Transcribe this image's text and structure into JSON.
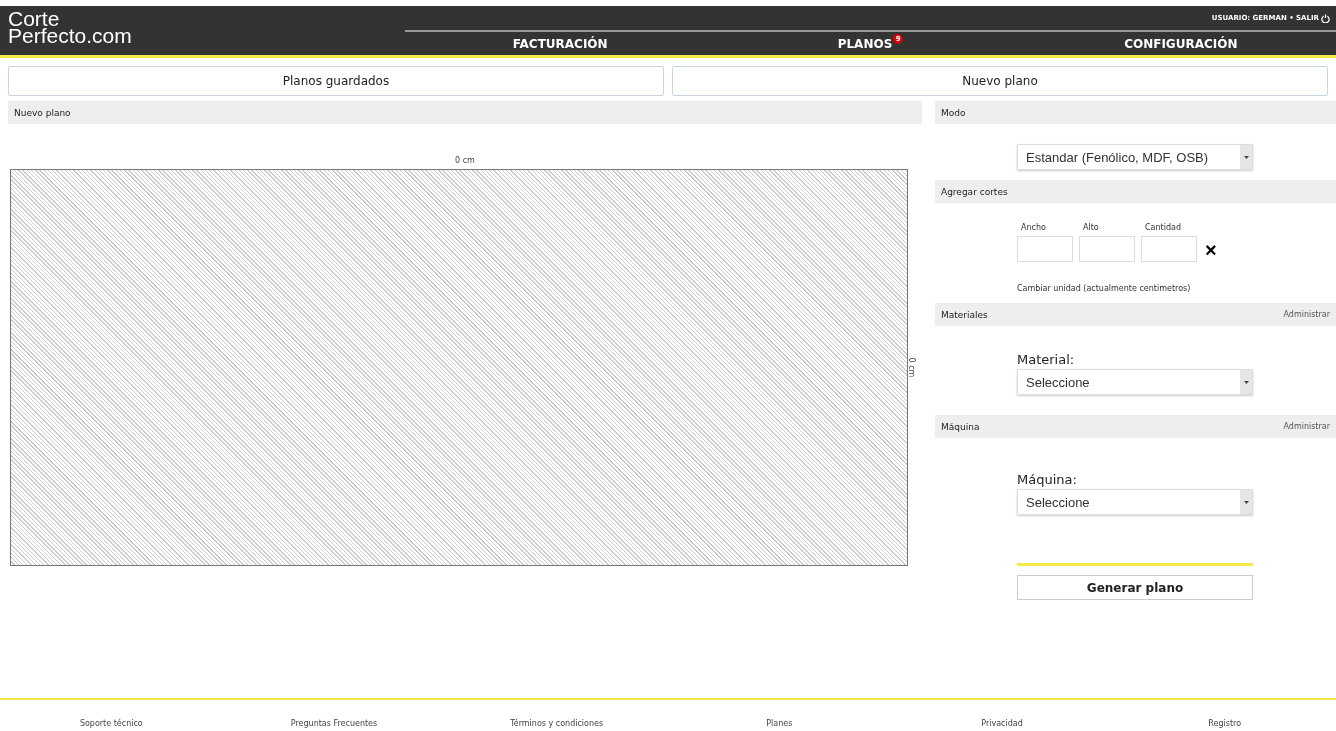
{
  "header": {
    "logo": [
      "Corte",
      "Perfecto.com"
    ],
    "user": "USUARIO: GERMAN • SALIR"
  },
  "nav": [
    {
      "label": "FACTURACIÓN"
    },
    {
      "label": "PLANOS",
      "badge": "9"
    },
    {
      "label": "CONFIGURACIÓN"
    }
  ],
  "tabs": [
    {
      "label": "Planos guardados"
    },
    {
      "label": "Nuevo plano"
    }
  ],
  "canvas_panel": {
    "title": "Nuevo plano",
    "width_label": "0 cm",
    "height_label": "0 cm"
  },
  "mode": {
    "title": "Modo",
    "select": "Estandar (Fenólico, MDF, OSB)"
  },
  "cuts": {
    "title": "Agregar cortes",
    "fields": [
      "Ancho",
      "Alto",
      "Cantidad"
    ],
    "remove": "×",
    "unit_link": "Cambiar unidad (actualmente centimetros)"
  },
  "materials": {
    "title": "Materiales",
    "manage": "Administrar",
    "label": "Material:",
    "select": "Seleccione"
  },
  "machine": {
    "title": "Máquina",
    "manage": "Administrar",
    "label": "Máquina:",
    "select": "Seleccione"
  },
  "generate_button": "Generar plano",
  "footer": [
    "Soporte técnico",
    "Preguntas Frecuentes",
    "Términos y condiciones",
    "Planes",
    "Privacidad",
    "Registro"
  ]
}
